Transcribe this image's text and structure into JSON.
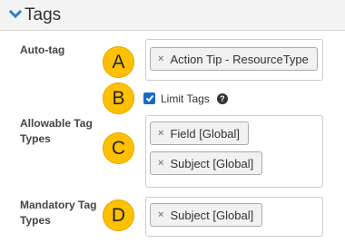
{
  "section": {
    "title": "Tags",
    "chevron_icon": "chevron-down-icon"
  },
  "fields": {
    "auto_tag": {
      "label": "Auto-tag",
      "badge": "A",
      "tags": [
        "Action Tip - ResourceType"
      ]
    },
    "limit_tags": {
      "badge": "B",
      "label": "Limit Tags",
      "checked": true,
      "help_icon": "question-circle-icon",
      "help_glyph": "?"
    },
    "allowable_tag_types": {
      "label": "Allowable Tag Types",
      "badge": "C",
      "tags": [
        "Field [Global]",
        "Subject [Global]"
      ]
    },
    "mandatory_tag_types": {
      "label": "Mandatory Tag Types",
      "badge": "D",
      "tags": [
        "Subject [Global]"
      ]
    }
  },
  "chip_remove_glyph": "×",
  "colors": {
    "badge": "#ffc000",
    "chevron": "#2a7fd0",
    "checkbox": "#1b6ac9",
    "header_background": "#f3f3f3"
  }
}
